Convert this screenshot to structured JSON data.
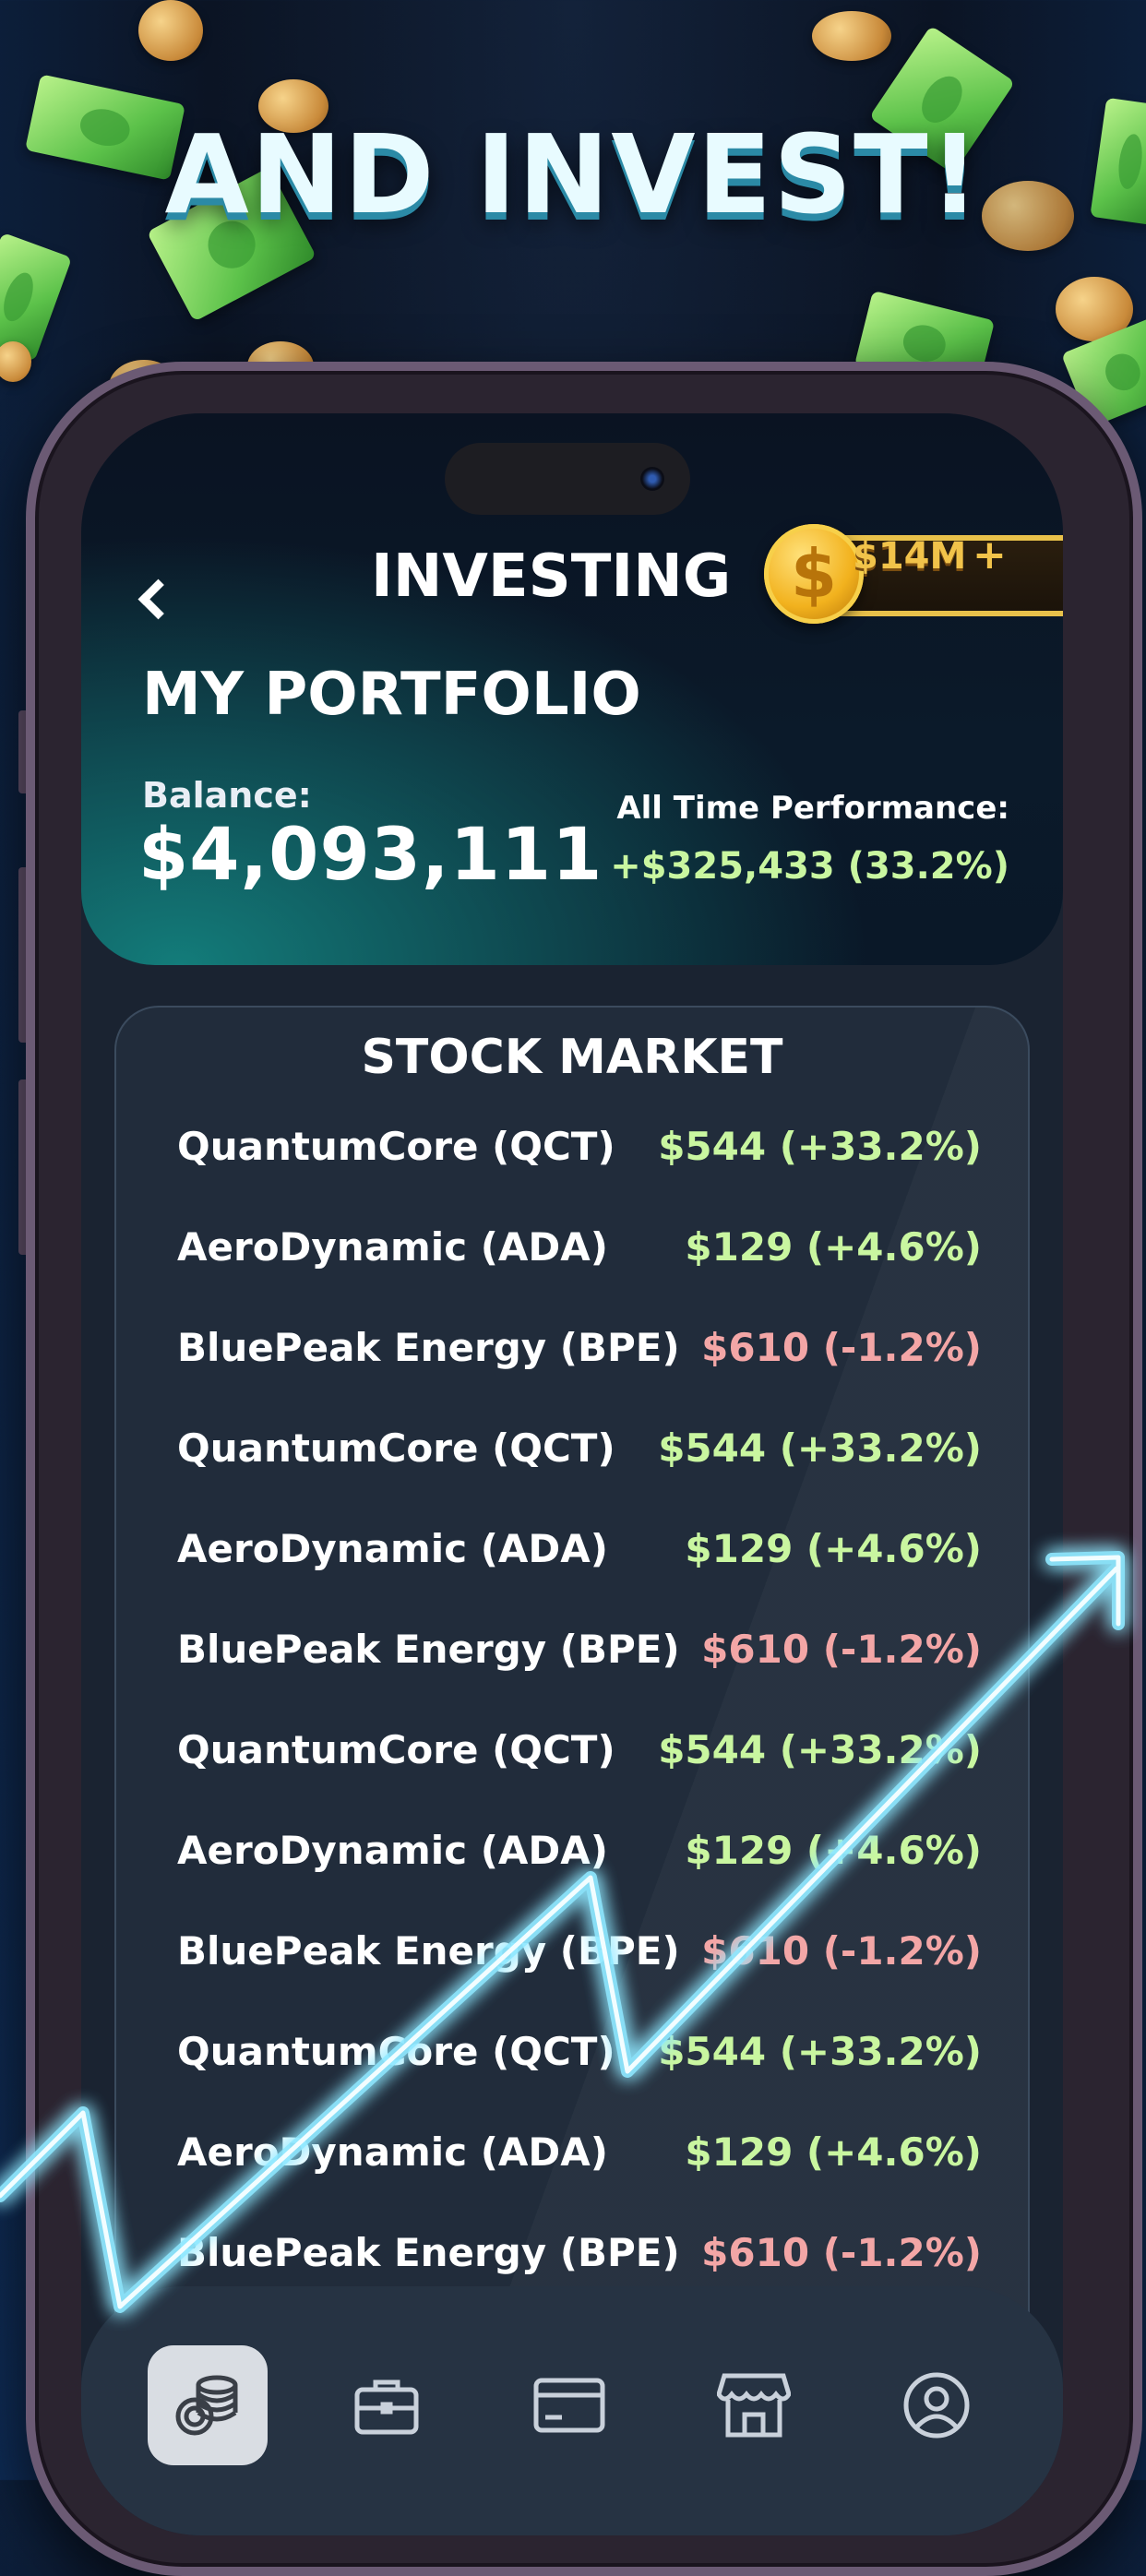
{
  "promo": {
    "title": "AND INVEST!"
  },
  "header": {
    "title": "INVESTING",
    "wallet_amount": "$14M",
    "wallet_plus": "+",
    "coin_symbol": "$"
  },
  "portfolio": {
    "title": "MY PORTFOLIO",
    "balance_label": "Balance:",
    "balance_value": "$4,093,111",
    "performance_label": "All Time Performance:",
    "performance_value": "+$325,433 (33.2%)"
  },
  "market": {
    "title": "STOCK MARKET",
    "rows": [
      {
        "name": "QuantumCore (QCT)",
        "price": "$544 (+33.2%)",
        "trend": "up"
      },
      {
        "name": "AeroDynamic (ADA)",
        "price": "$129 (+4.6%)",
        "trend": "up"
      },
      {
        "name": "BluePeak Energy (BPE)",
        "price": "$610 (-1.2%)",
        "trend": "down"
      },
      {
        "name": "QuantumCore (QCT)",
        "price": "$544 (+33.2%)",
        "trend": "up"
      },
      {
        "name": "AeroDynamic (ADA)",
        "price": "$129 (+4.6%)",
        "trend": "up"
      },
      {
        "name": "BluePeak Energy (BPE)",
        "price": "$610 (-1.2%)",
        "trend": "down"
      },
      {
        "name": "QuantumCore (QCT)",
        "price": "$544 (+33.2%)",
        "trend": "up"
      },
      {
        "name": "AeroDynamic (ADA)",
        "price": "$129 (+4.6%)",
        "trend": "up"
      },
      {
        "name": "BluePeak Energy (BPE)",
        "price": "$610 (-1.2%)",
        "trend": "down"
      },
      {
        "name": "QuantumCore (QCT)",
        "price": "$544 (+33.2%)",
        "trend": "up"
      },
      {
        "name": "AeroDynamic (ADA)",
        "price": "$129 (+4.6%)",
        "trend": "up"
      },
      {
        "name": "BluePeak Energy (BPE)",
        "price": "$610 (-1.2%)",
        "trend": "down"
      }
    ]
  },
  "nav": {
    "items": [
      {
        "icon": "coins-icon",
        "active": true
      },
      {
        "icon": "briefcase-icon",
        "active": false
      },
      {
        "icon": "credit-card-icon",
        "active": false
      },
      {
        "icon": "store-icon",
        "active": false
      },
      {
        "icon": "user-icon",
        "active": false
      }
    ]
  },
  "colors": {
    "gain": "#c9f6a0",
    "loss": "#f3a6a6",
    "gold": "#f1c34a",
    "glow": "#8fe8ff"
  }
}
